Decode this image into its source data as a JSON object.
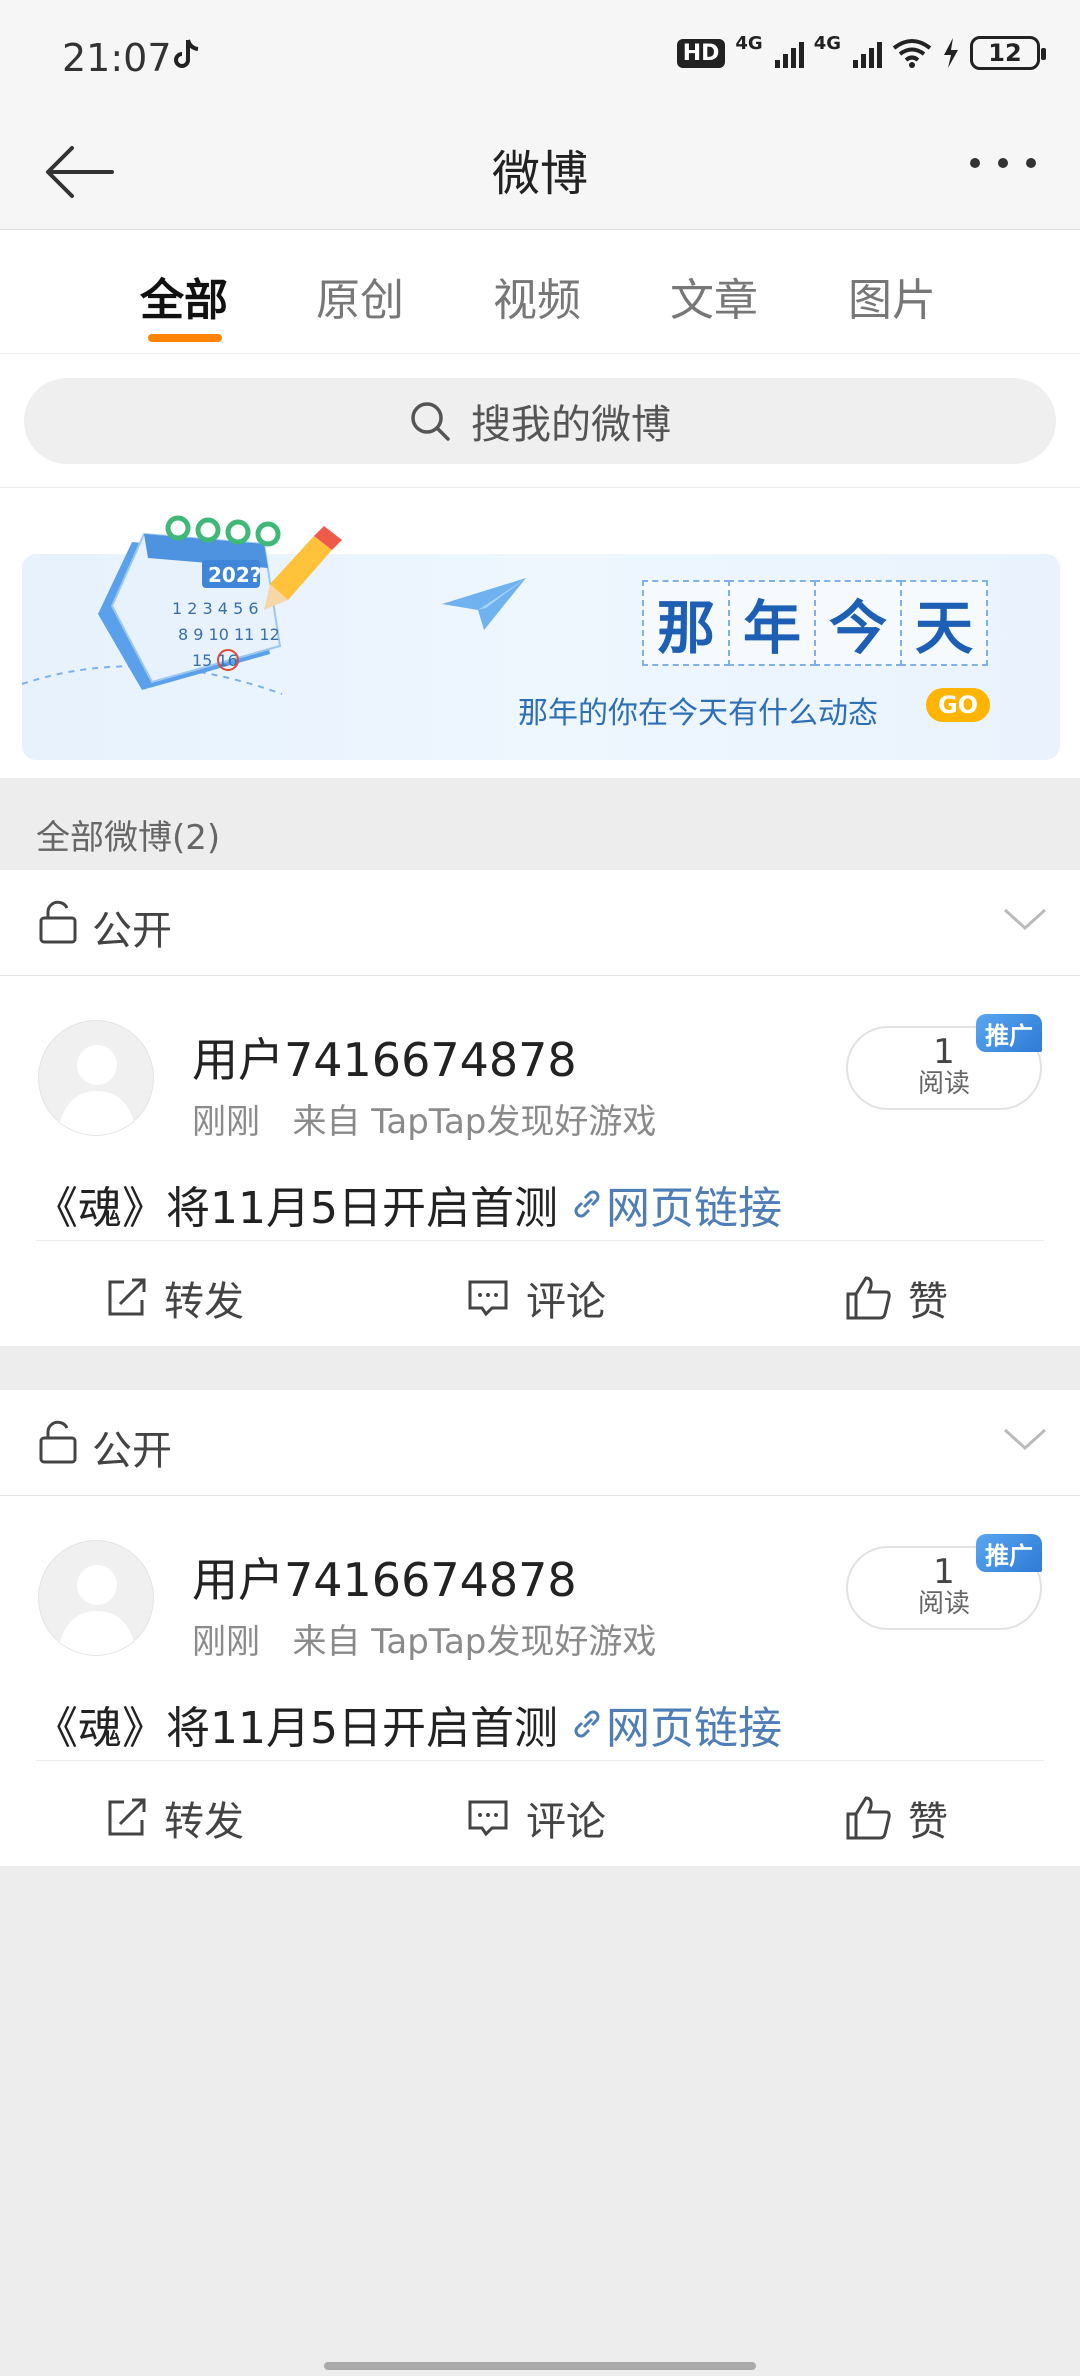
{
  "status_bar": {
    "time": "21:07",
    "hd_label": "HD",
    "net1": "4G",
    "net2": "4G",
    "battery": "12"
  },
  "nav": {
    "title": "微博"
  },
  "tabs": [
    {
      "label": "全部",
      "active": true
    },
    {
      "label": "原创",
      "active": false
    },
    {
      "label": "视频",
      "active": false
    },
    {
      "label": "文章",
      "active": false
    },
    {
      "label": "图片",
      "active": false
    }
  ],
  "search": {
    "placeholder": "搜我的微博"
  },
  "banner": {
    "title_chars": [
      "那",
      "年",
      "今",
      "天"
    ],
    "subtitle": "那年的你在今天有什么动态",
    "go": "GO",
    "calendar_year": "202?"
  },
  "count_header": "全部微博(2)",
  "posts": [
    {
      "visibility": "公开",
      "username": "用户7416674878",
      "time": "刚刚",
      "source": "来自 TapTap发现好游戏",
      "read_count": "1",
      "read_label": "阅读",
      "promo": "推广",
      "text": "《魂》将11月5日开启首测",
      "link_text": "网页链接",
      "actions": {
        "repost": "转发",
        "comment": "评论",
        "like": "赞"
      }
    },
    {
      "visibility": "公开",
      "username": "用户7416674878",
      "time": "刚刚",
      "source": "来自 TapTap发现好游戏",
      "read_count": "1",
      "read_label": "阅读",
      "promo": "推广",
      "text": "《魂》将11月5日开启首测",
      "link_text": "网页链接",
      "actions": {
        "repost": "转发",
        "comment": "评论",
        "like": "赞"
      }
    }
  ],
  "colors": {
    "accent": "#ff8200",
    "link": "#4f7db5",
    "banner_blue": "#1c5fb5"
  }
}
